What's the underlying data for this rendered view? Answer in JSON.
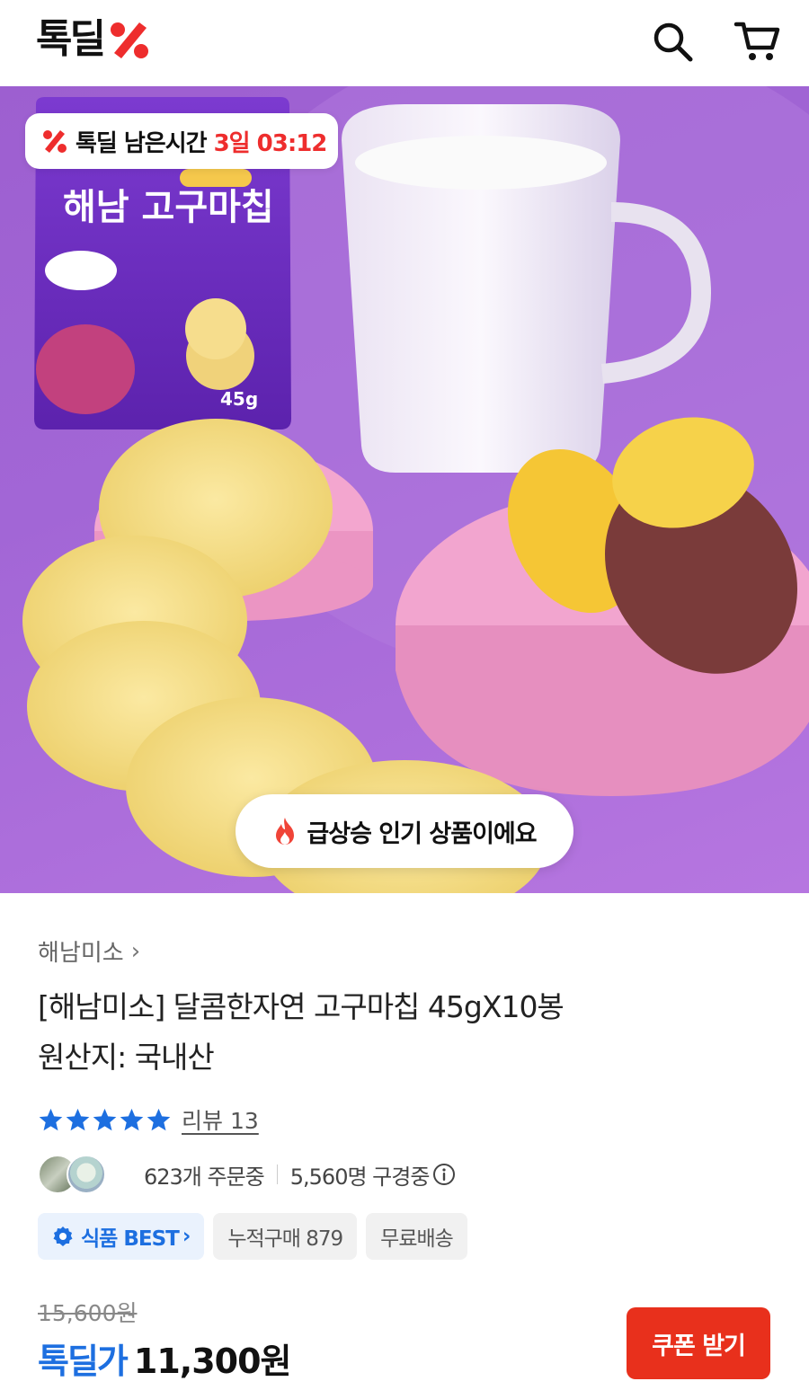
{
  "header": {
    "logo_text": "톡딜",
    "icons": [
      "search-icon",
      "cart-icon"
    ]
  },
  "hero": {
    "timer_label": "톡딜 남은시간",
    "timer_value": "3일 03:12",
    "trend_label": "급상승 인기 상품이에요"
  },
  "product": {
    "brand": "해남미소",
    "title": "[해남미소] 달콤한자연 고구마칩 45gX10봉",
    "origin": "원산지: 국내산",
    "rating_stars": 5,
    "review_label": "리뷰 13",
    "orders_text": "623개 주문중",
    "watching_text": "5,560명 구경중",
    "badges": {
      "best": "식품 BEST",
      "cumulative": "누적구매 879",
      "shipping": "무료배송"
    },
    "original_price": "15,600원",
    "deal_label": "톡딜가",
    "deal_price": "11,300원",
    "coupon_button": "쿠폰 받기"
  },
  "colors": {
    "accent_red": "#ee2d2d",
    "accent_blue": "#1d6fe0",
    "coupon_bg": "#e8301c"
  }
}
